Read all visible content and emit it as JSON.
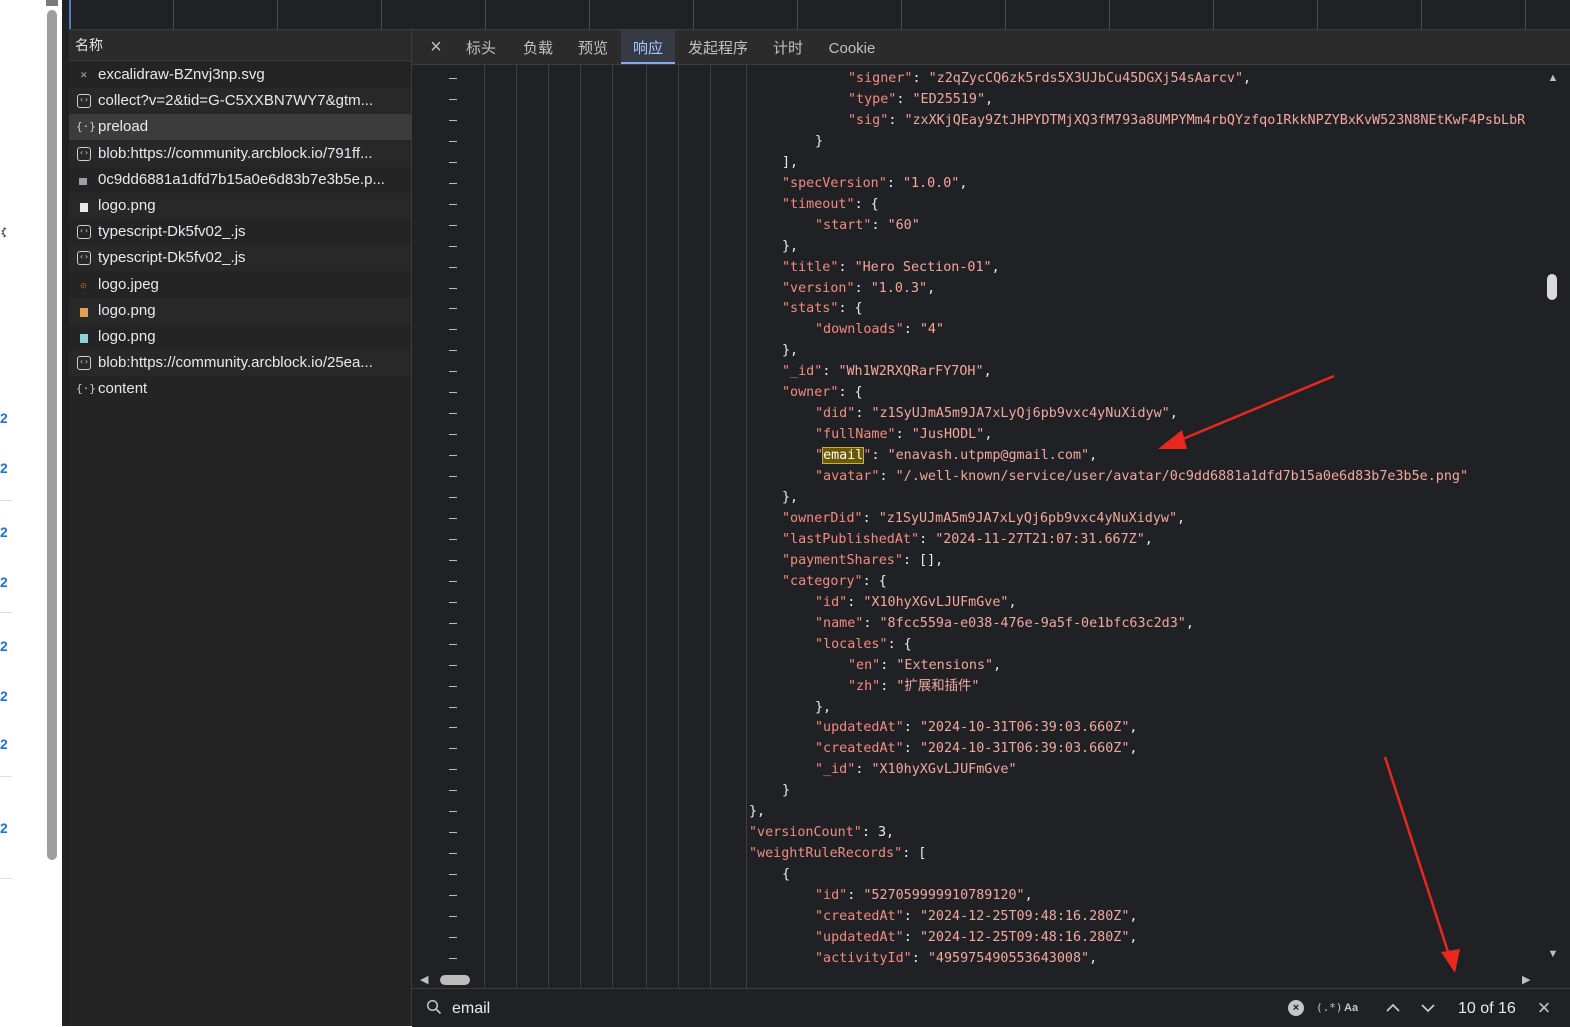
{
  "name_panel": {
    "header": "名称",
    "requests": [
      {
        "name": "excalidraw-BZnvj3np.svg",
        "icon": "svg-file-icon"
      },
      {
        "name": "collect?v=2&tid=G-C5XXBN7WY7&gtm...",
        "icon": "document-icon"
      },
      {
        "name": "preload",
        "icon": "fetch-icon"
      },
      {
        "name": "blob:https://community.arcblock.io/791ff...",
        "icon": "document-icon"
      },
      {
        "name": "0c9dd6881a1dfd7b15a0e6d83b7e3b5e.p...",
        "icon": "image-icon"
      },
      {
        "name": "logo.png",
        "icon": "image-icon"
      },
      {
        "name": "typescript-Dk5fv02_.js",
        "icon": "document-icon"
      },
      {
        "name": "typescript-Dk5fv02_.js",
        "icon": "document-icon"
      },
      {
        "name": "logo.jpeg",
        "icon": "image-icon"
      },
      {
        "name": "logo.png",
        "icon": "image-icon"
      },
      {
        "name": "logo.png",
        "icon": "image-icon"
      },
      {
        "name": "blob:https://community.arcblock.io/25ea...",
        "icon": "document-icon"
      },
      {
        "name": "content",
        "icon": "fetch-icon"
      }
    ]
  },
  "tabs": {
    "close": "×",
    "items": [
      "标头",
      "负载",
      "预览",
      "响应",
      "发起程序",
      "计时",
      "Cookie"
    ],
    "active": "响应"
  },
  "response_lines": [
    {
      "i": 3,
      "t": [
        [
          "k",
          "\"signer\""
        ],
        [
          "p",
          ": "
        ],
        [
          "s",
          "\"z2qZycCQ6zk5rds5X3UJbCu45DGXj54sAarcv\""
        ],
        [
          "p",
          ","
        ]
      ]
    },
    {
      "i": 3,
      "t": [
        [
          "k",
          "\"type\""
        ],
        [
          "p",
          ": "
        ],
        [
          "s",
          "\"ED25519\""
        ],
        [
          "p",
          ","
        ]
      ]
    },
    {
      "i": 3,
      "t": [
        [
          "k",
          "\"sig\""
        ],
        [
          "p",
          ": "
        ],
        [
          "s",
          "\"zxXKjQEay9ZtJHPYDTMjXQ3fM793a8UMPYMm4rbQYzfqo1RkkNPZYBxKvW523N8NEtKwF4PsbLbR"
        ]
      ]
    },
    {
      "i": 2,
      "t": [
        [
          "p",
          "}"
        ]
      ]
    },
    {
      "i": 1,
      "t": [
        [
          "p",
          "],"
        ]
      ]
    },
    {
      "i": 1,
      "t": [
        [
          "k",
          "\"specVersion\""
        ],
        [
          "p",
          ": "
        ],
        [
          "s",
          "\"1.0.0\""
        ],
        [
          "p",
          ","
        ]
      ]
    },
    {
      "i": 1,
      "t": [
        [
          "k",
          "\"timeout\""
        ],
        [
          "p",
          ": {"
        ]
      ]
    },
    {
      "i": 2,
      "t": [
        [
          "k",
          "\"start\""
        ],
        [
          "p",
          ": "
        ],
        [
          "s",
          "\"60\""
        ]
      ]
    },
    {
      "i": 1,
      "t": [
        [
          "p",
          "},"
        ]
      ]
    },
    {
      "i": 1,
      "t": [
        [
          "k",
          "\"title\""
        ],
        [
          "p",
          ": "
        ],
        [
          "s",
          "\"Hero Section-01\""
        ],
        [
          "p",
          ","
        ]
      ]
    },
    {
      "i": 1,
      "t": [
        [
          "k",
          "\"version\""
        ],
        [
          "p",
          ": "
        ],
        [
          "s",
          "\"1.0.3\""
        ],
        [
          "p",
          ","
        ]
      ]
    },
    {
      "i": 1,
      "t": [
        [
          "k",
          "\"stats\""
        ],
        [
          "p",
          ": {"
        ]
      ]
    },
    {
      "i": 2,
      "t": [
        [
          "k",
          "\"downloads\""
        ],
        [
          "p",
          ": "
        ],
        [
          "s",
          "\"4\""
        ]
      ]
    },
    {
      "i": 1,
      "t": [
        [
          "p",
          "},"
        ]
      ]
    },
    {
      "i": 1,
      "t": [
        [
          "k",
          "\"_id\""
        ],
        [
          "p",
          ": "
        ],
        [
          "s",
          "\"Wh1W2RXQRarFY7OH\""
        ],
        [
          "p",
          ","
        ]
      ]
    },
    {
      "i": 1,
      "t": [
        [
          "k",
          "\"owner\""
        ],
        [
          "p",
          ": {"
        ]
      ]
    },
    {
      "i": 2,
      "t": [
        [
          "k",
          "\"did\""
        ],
        [
          "p",
          ": "
        ],
        [
          "s",
          "\"z1SyUJmA5m9JA7xLyQj6pb9vxc4yNuXidyw\""
        ],
        [
          "p",
          ","
        ]
      ]
    },
    {
      "i": 2,
      "t": [
        [
          "k",
          "\"fullName\""
        ],
        [
          "p",
          ": "
        ],
        [
          "s",
          "\"JusHODL\""
        ],
        [
          "p",
          ","
        ]
      ]
    },
    {
      "i": 2,
      "t": [
        [
          "k",
          "\""
        ],
        [
          "h",
          "email"
        ],
        [
          "k",
          "\""
        ],
        [
          "p",
          ": "
        ],
        [
          "s",
          "\"enavash.utpmp@gmail.com\""
        ],
        [
          "p",
          ","
        ]
      ]
    },
    {
      "i": 2,
      "t": [
        [
          "k",
          "\"avatar\""
        ],
        [
          "p",
          ": "
        ],
        [
          "s",
          "\"/.well-known/service/user/avatar/0c9dd6881a1dfd7b15a0e6d83b7e3b5e.png\""
        ]
      ]
    },
    {
      "i": 1,
      "t": [
        [
          "p",
          "},"
        ]
      ]
    },
    {
      "i": 1,
      "t": [
        [
          "k",
          "\"ownerDid\""
        ],
        [
          "p",
          ": "
        ],
        [
          "s",
          "\"z1SyUJmA5m9JA7xLyQj6pb9vxc4yNuXidyw\""
        ],
        [
          "p",
          ","
        ]
      ]
    },
    {
      "i": 1,
      "t": [
        [
          "k",
          "\"lastPublishedAt\""
        ],
        [
          "p",
          ": "
        ],
        [
          "s",
          "\"2024-11-27T21:07:31.667Z\""
        ],
        [
          "p",
          ","
        ]
      ]
    },
    {
      "i": 1,
      "t": [
        [
          "k",
          "\"paymentShares\""
        ],
        [
          "p",
          ": [],"
        ]
      ]
    },
    {
      "i": 1,
      "t": [
        [
          "k",
          "\"category\""
        ],
        [
          "p",
          ": {"
        ]
      ]
    },
    {
      "i": 2,
      "t": [
        [
          "k",
          "\"id\""
        ],
        [
          "p",
          ": "
        ],
        [
          "s",
          "\"X10hyXGvLJUFmGve\""
        ],
        [
          "p",
          ","
        ]
      ]
    },
    {
      "i": 2,
      "t": [
        [
          "k",
          "\"name\""
        ],
        [
          "p",
          ": "
        ],
        [
          "s",
          "\"8fcc559a-e038-476e-9a5f-0e1bfc63c2d3\""
        ],
        [
          "p",
          ","
        ]
      ]
    },
    {
      "i": 2,
      "t": [
        [
          "k",
          "\"locales\""
        ],
        [
          "p",
          ": {"
        ]
      ]
    },
    {
      "i": 3,
      "t": [
        [
          "k",
          "\"en\""
        ],
        [
          "p",
          ": "
        ],
        [
          "s",
          "\"Extensions\""
        ],
        [
          "p",
          ","
        ]
      ]
    },
    {
      "i": 3,
      "t": [
        [
          "k",
          "\"zh\""
        ],
        [
          "p",
          ": "
        ],
        [
          "s",
          "\"扩展和插件\""
        ]
      ]
    },
    {
      "i": 2,
      "t": [
        [
          "p",
          "},"
        ]
      ]
    },
    {
      "i": 2,
      "t": [
        [
          "k",
          "\"updatedAt\""
        ],
        [
          "p",
          ": "
        ],
        [
          "s",
          "\"2024-10-31T06:39:03.660Z\""
        ],
        [
          "p",
          ","
        ]
      ]
    },
    {
      "i": 2,
      "t": [
        [
          "k",
          "\"createdAt\""
        ],
        [
          "p",
          ": "
        ],
        [
          "s",
          "\"2024-10-31T06:39:03.660Z\""
        ],
        [
          "p",
          ","
        ]
      ]
    },
    {
      "i": 2,
      "t": [
        [
          "k",
          "\"_id\""
        ],
        [
          "p",
          ": "
        ],
        [
          "s",
          "\"X10hyXGvLJUFmGve\""
        ]
      ]
    },
    {
      "i": 1,
      "t": [
        [
          "p",
          "}"
        ]
      ]
    },
    {
      "i": 0,
      "t": [
        [
          "p",
          "},"
        ]
      ]
    },
    {
      "i": 0,
      "t": [
        [
          "k",
          "\"versionCount\""
        ],
        [
          "p",
          ": 3,"
        ]
      ]
    },
    {
      "i": 0,
      "t": [
        [
          "k",
          "\"weightRuleRecords\""
        ],
        [
          "p",
          ": ["
        ]
      ]
    },
    {
      "i": 1,
      "t": [
        [
          "p",
          "{"
        ]
      ]
    },
    {
      "i": 2,
      "t": [
        [
          "k",
          "\"id\""
        ],
        [
          "p",
          ": "
        ],
        [
          "s",
          "\"527059999910789120\""
        ],
        [
          "p",
          ","
        ]
      ]
    },
    {
      "i": 2,
      "t": [
        [
          "k",
          "\"createdAt\""
        ],
        [
          "p",
          ": "
        ],
        [
          "s",
          "\"2024-12-25T09:48:16.280Z\""
        ],
        [
          "p",
          ","
        ]
      ]
    },
    {
      "i": 2,
      "t": [
        [
          "k",
          "\"updatedAt\""
        ],
        [
          "p",
          ": "
        ],
        [
          "s",
          "\"2024-12-25T09:48:16.280Z\""
        ],
        [
          "p",
          ","
        ]
      ]
    },
    {
      "i": 2,
      "t": [
        [
          "k",
          "\"activityId\""
        ],
        [
          "p",
          ": "
        ],
        [
          "s",
          "\"495975490553643008\""
        ],
        [
          "p",
          ","
        ]
      ]
    }
  ],
  "search": {
    "value": "email",
    "regex_label": "(.*)",
    "case_label": "Aa",
    "match_count": "10 of 16",
    "clear_label": "×",
    "close_label": "×"
  },
  "colors": {
    "key": "#f28b82",
    "string": "#f3a79e",
    "highlight": "#6b5a00",
    "active_tab": "#a8c7fa",
    "annotation_arrow": "#e8271e"
  }
}
